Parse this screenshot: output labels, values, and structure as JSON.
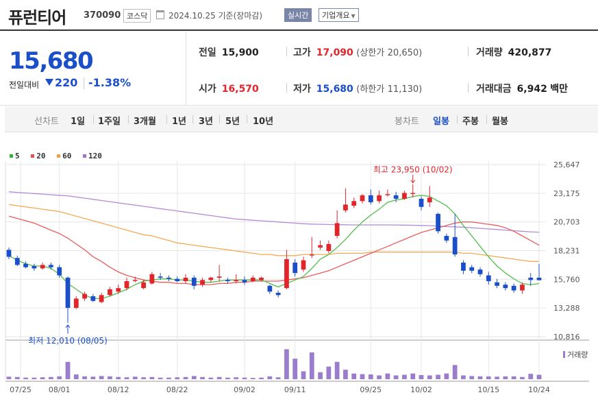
{
  "header": {
    "name": "퓨런티어",
    "code": "370090",
    "market": "코스닥",
    "date_label": "2024.10.25 기준(장마감)",
    "realtime_label": "실시간",
    "company_label": "기업개요"
  },
  "summary": {
    "price": "15,680",
    "prev_label": "전일대비",
    "change": "220",
    "change_pct": "-1.38%",
    "prev_close_label": "전일",
    "prev_close": "15,900",
    "high_label": "고가",
    "high": "17,090",
    "upper_label": "(상한가",
    "upper": "20,650)",
    "volume_label": "거래량",
    "volume": "420,877",
    "open_label": "시가",
    "open": "16,570",
    "low_label": "저가",
    "low": "15,680",
    "lower_label": "(하한가",
    "lower": "11,130)",
    "amount_label": "거래대금",
    "amount": "6,942",
    "amount_unit": "백만"
  },
  "toolbar": {
    "line_chart_label": "선차트",
    "periods": [
      "1일",
      "1주일",
      "3개월",
      "1년",
      "3년",
      "5년",
      "10년"
    ],
    "candle_label": "봉차트",
    "candle_periods": [
      "일봉",
      "주봉",
      "월봉"
    ],
    "active_candle": "일봉"
  },
  "legend": [
    {
      "label": "5",
      "color": "#2db52d"
    },
    {
      "label": "20",
      "color": "#e84c4c"
    },
    {
      "label": "60",
      "color": "#f0a040"
    },
    {
      "label": "120",
      "color": "#a070d0"
    }
  ],
  "chart_data": {
    "type": "candlestick",
    "y_ticks": [
      "25,647",
      "23,175",
      "20,703",
      "18,231",
      "15,760",
      "13,288",
      "10,816"
    ],
    "y_tick_values": [
      25647,
      23175,
      20703,
      18231,
      15760,
      13288,
      10816
    ],
    "x_ticks": [
      "07/25",
      "08/01",
      "08/12",
      "08/22",
      "09/02",
      "09/11",
      "09/25",
      "10/02",
      "10/15",
      "10/24"
    ],
    "high_annotation": "최고 23,950 (10/02)",
    "low_annotation": "최저 12,010 (08/05)",
    "volume_label": "거래량",
    "candles": [
      {
        "o": 18300,
        "c": 17700,
        "h": 18500,
        "l": 17500
      },
      {
        "o": 17600,
        "c": 17000,
        "h": 17800,
        "l": 16900
      },
      {
        "o": 17100,
        "c": 16800,
        "h": 17300,
        "l": 16700
      },
      {
        "o": 16900,
        "c": 16700,
        "h": 17100,
        "l": 16500
      },
      {
        "o": 16700,
        "c": 17000,
        "h": 17200,
        "l": 16600
      },
      {
        "o": 17000,
        "c": 16800,
        "h": 17200,
        "l": 16600
      },
      {
        "o": 16800,
        "c": 16100,
        "h": 17000,
        "l": 15900
      },
      {
        "o": 15900,
        "c": 13300,
        "h": 16000,
        "l": 12010
      },
      {
        "o": 13300,
        "c": 14100,
        "h": 14300,
        "l": 13200
      },
      {
        "o": 14100,
        "c": 14500,
        "h": 14700,
        "l": 13900
      },
      {
        "o": 14300,
        "c": 13900,
        "h": 14500,
        "l": 13800
      },
      {
        "o": 13800,
        "c": 14400,
        "h": 14600,
        "l": 13700
      },
      {
        "o": 14400,
        "c": 14900,
        "h": 15100,
        "l": 14300
      },
      {
        "o": 14700,
        "c": 15000,
        "h": 15300,
        "l": 14500
      },
      {
        "o": 15000,
        "c": 15600,
        "h": 15900,
        "l": 14800
      },
      {
        "o": 15700,
        "c": 15700,
        "h": 16000,
        "l": 15500
      },
      {
        "o": 15000,
        "c": 15500,
        "h": 15700,
        "l": 14900
      },
      {
        "o": 15400,
        "c": 16200,
        "h": 16400,
        "l": 15300
      },
      {
        "o": 16000,
        "c": 15900,
        "h": 16300,
        "l": 15700
      },
      {
        "o": 15900,
        "c": 15800,
        "h": 16100,
        "l": 15600
      },
      {
        "o": 15800,
        "c": 15600,
        "h": 16000,
        "l": 15500
      },
      {
        "o": 15600,
        "c": 15900,
        "h": 16200,
        "l": 15400
      },
      {
        "o": 15900,
        "c": 15200,
        "h": 16100,
        "l": 14900
      },
      {
        "o": 15300,
        "c": 15700,
        "h": 15900,
        "l": 15100
      },
      {
        "o": 15700,
        "c": 15900,
        "h": 16000,
        "l": 15500
      },
      {
        "o": 15900,
        "c": 16000,
        "h": 17000,
        "l": 15600
      },
      {
        "o": 15700,
        "c": 15600,
        "h": 15900,
        "l": 15400
      },
      {
        "o": 15600,
        "c": 15700,
        "h": 16200,
        "l": 15400
      },
      {
        "o": 15700,
        "c": 15500,
        "h": 16000,
        "l": 15300
      },
      {
        "o": 15600,
        "c": 15900,
        "h": 16100,
        "l": 15500
      },
      {
        "o": 15700,
        "c": 15900,
        "h": 16000,
        "l": 15600
      },
      {
        "o": 15200,
        "c": 14700,
        "h": 15300,
        "l": 14500
      },
      {
        "o": 14600,
        "c": 14400,
        "h": 14800,
        "l": 14200
      },
      {
        "o": 15000,
        "c": 17500,
        "h": 18300,
        "l": 14900
      },
      {
        "o": 17200,
        "c": 16300,
        "h": 17500,
        "l": 16000
      },
      {
        "o": 16600,
        "c": 17400,
        "h": 17700,
        "l": 16400
      },
      {
        "o": 17900,
        "c": 17900,
        "h": 19400,
        "l": 17600
      },
      {
        "o": 18500,
        "c": 18700,
        "h": 19100,
        "l": 18300
      },
      {
        "o": 18200,
        "c": 18800,
        "h": 19100,
        "l": 18000
      },
      {
        "o": 19500,
        "c": 20600,
        "h": 21700,
        "l": 19300
      },
      {
        "o": 21700,
        "c": 22200,
        "h": 23600,
        "l": 21500
      },
      {
        "o": 22100,
        "c": 22500,
        "h": 22800,
        "l": 21900
      },
      {
        "o": 22500,
        "c": 23000,
        "h": 23100,
        "l": 22300
      },
      {
        "o": 23000,
        "c": 22400,
        "h": 23500,
        "l": 22200
      },
      {
        "o": 22500,
        "c": 23000,
        "h": 23400,
        "l": 22300
      },
      {
        "o": 23100,
        "c": 23100,
        "h": 23500,
        "l": 22900
      },
      {
        "o": 23000,
        "c": 22700,
        "h": 23300,
        "l": 22400
      },
      {
        "o": 22700,
        "c": 23200,
        "h": 23400,
        "l": 22600
      },
      {
        "o": 23200,
        "c": 23200,
        "h": 23950,
        "l": 22800
      },
      {
        "o": 22700,
        "c": 22000,
        "h": 22900,
        "l": 21700
      },
      {
        "o": 22400,
        "c": 22800,
        "h": 23800,
        "l": 22000
      },
      {
        "o": 21400,
        "c": 19900,
        "h": 21500,
        "l": 19700
      },
      {
        "o": 19500,
        "c": 19100,
        "h": 19700,
        "l": 18900
      },
      {
        "o": 19400,
        "c": 17900,
        "h": 21400,
        "l": 17700
      },
      {
        "o": 17200,
        "c": 16500,
        "h": 17400,
        "l": 16200
      },
      {
        "o": 16800,
        "c": 16500,
        "h": 17000,
        "l": 16300
      },
      {
        "o": 16600,
        "c": 16200,
        "h": 16800,
        "l": 16000
      },
      {
        "o": 16100,
        "c": 15600,
        "h": 16400,
        "l": 15300
      },
      {
        "o": 15500,
        "c": 15200,
        "h": 15800,
        "l": 15000
      },
      {
        "o": 15300,
        "c": 15000,
        "h": 15500,
        "l": 14800
      },
      {
        "o": 15200,
        "c": 14800,
        "h": 15400,
        "l": 14600
      },
      {
        "o": 14800,
        "c": 15300,
        "h": 15500,
        "l": 14500
      },
      {
        "o": 15900,
        "c": 15700,
        "h": 16300,
        "l": 15200
      },
      {
        "o": 15900,
        "c": 15680,
        "h": 17090,
        "l": 15680
      }
    ],
    "volume": [
      0.08,
      0.07,
      0.05,
      0.05,
      0.06,
      0.07,
      0.09,
      0.55,
      0.15,
      0.09,
      0.08,
      0.1,
      0.09,
      0.07,
      0.06,
      0.08,
      0.06,
      0.07,
      0.05,
      0.05,
      0.06,
      0.07,
      0.1,
      0.07,
      0.05,
      0.07,
      0.05,
      0.06,
      0.05,
      0.04,
      0.05,
      0.09,
      0.06,
      0.95,
      0.65,
      0.25,
      0.85,
      0.22,
      0.4,
      0.55,
      0.3,
      0.18,
      0.16,
      0.15,
      0.12,
      0.18,
      0.12,
      0.14,
      0.18,
      0.13,
      0.12,
      0.14,
      0.18,
      0.45,
      0.12,
      0.1,
      0.09,
      0.09,
      0.08,
      0.09,
      0.09,
      0.07,
      0.17,
      0.14
    ],
    "ma5": [
      17800,
      17400,
      17100,
      16900,
      16900,
      16700,
      16200,
      15400,
      14900,
      14400,
      14100,
      14100,
      14300,
      14600,
      14900,
      15300,
      15600,
      15700,
      15800,
      15800,
      15700,
      15700,
      15600,
      15500,
      15500,
      15600,
      15700,
      15700,
      15700,
      15700,
      15700,
      15400,
      15100,
      15400,
      15700,
      16000,
      16700,
      17500,
      17900,
      18500,
      19200,
      20000,
      20700,
      21300,
      21800,
      22400,
      22600,
      22700,
      22900,
      23000,
      22900,
      22500,
      22100,
      21400,
      20400,
      19500,
      18600,
      17700,
      16900,
      16300,
      15800,
      15400,
      15300,
      15400
    ],
    "ma20": [
      21200,
      21000,
      20800,
      20600,
      20300,
      20000,
      19700,
      19300,
      18800,
      18300,
      17700,
      17300,
      16800,
      16400,
      16100,
      15900,
      15700,
      15600,
      15500,
      15500,
      15400,
      15400,
      15300,
      15300,
      15300,
      15400,
      15400,
      15500,
      15500,
      15600,
      15600,
      15600,
      15600,
      15700,
      15800,
      15900,
      16100,
      16300,
      16500,
      16800,
      17100,
      17400,
      17700,
      18000,
      18300,
      18600,
      18900,
      19200,
      19500,
      19800,
      20000,
      20200,
      20400,
      20600,
      20700,
      20700,
      20600,
      20500,
      20400,
      20200,
      19900,
      19500,
      19100,
      18700
    ],
    "ma60": [
      22200,
      22100,
      22000,
      21900,
      21800,
      21700,
      21600,
      21400,
      21200,
      21000,
      20800,
      20600,
      20400,
      20200,
      20000,
      19800,
      19600,
      19500,
      19300,
      19100,
      18900,
      18800,
      18700,
      18600,
      18500,
      18400,
      18300,
      18200,
      18100,
      18000,
      17900,
      17900,
      17800,
      17800,
      17800,
      17900,
      17900,
      17900,
      17900,
      18000,
      18000,
      18000,
      18000,
      18100,
      18100,
      18100,
      18100,
      18100,
      18100,
      18100,
      18100,
      18100,
      18100,
      18100,
      18000,
      18000,
      17900,
      17800,
      17700,
      17600,
      17500,
      17400,
      17300,
      17300
    ],
    "ma120": [
      23300,
      23250,
      23200,
      23150,
      23100,
      23050,
      23000,
      22950,
      22850,
      22750,
      22650,
      22550,
      22450,
      22350,
      22250,
      22150,
      22050,
      21950,
      21850,
      21750,
      21650,
      21550,
      21450,
      21350,
      21250,
      21150,
      21050,
      20950,
      20900,
      20850,
      20800,
      20750,
      20700,
      20650,
      20600,
      20550,
      20520,
      20500,
      20480,
      20470,
      20460,
      20450,
      20450,
      20450,
      20450,
      20450,
      20440,
      20430,
      20420,
      20400,
      20380,
      20350,
      20300,
      20280,
      20250,
      20200,
      20150,
      20100,
      20050,
      20000,
      19950,
      19900,
      19850,
      19820
    ]
  }
}
